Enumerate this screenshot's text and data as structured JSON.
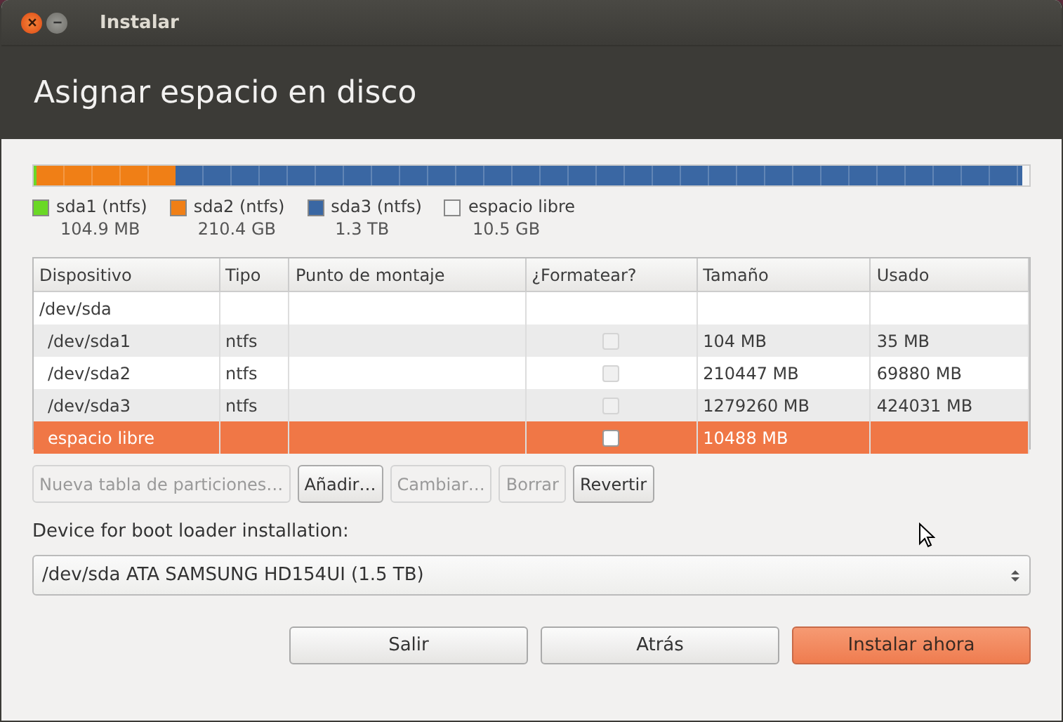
{
  "window": {
    "title": "Instalar"
  },
  "header": {
    "title": "Asignar espacio en disco"
  },
  "partition_bar": {
    "segments": [
      {
        "color": "#6ad825",
        "level": 0.001
      },
      {
        "color": "#f07f16",
        "level": 0.14
      },
      {
        "color": "#3a67a3",
        "level": 0.852
      },
      {
        "color": "#f4f4f4",
        "level": 0.007
      }
    ]
  },
  "legend": [
    {
      "name": "sda1 (ntfs)",
      "size": "104.9 MB",
      "color": "#6ad825"
    },
    {
      "name": "sda2 (ntfs)",
      "size": "210.4 GB",
      "color": "#f07f16"
    },
    {
      "name": "sda3 (ntfs)",
      "size": "1.3 TB",
      "color": "#3a67a3"
    },
    {
      "name": "espacio libre",
      "size": "10.5 GB",
      "color": "#f4f4f4"
    }
  ],
  "table": {
    "columns": [
      "Dispositivo",
      "Tipo",
      "Punto de montaje",
      "¿Formatear?",
      "Tamaño",
      "Usado"
    ],
    "rows": [
      {
        "kind": "disk",
        "device": "/dev/sda",
        "selected": false
      },
      {
        "kind": "partition",
        "device": "/dev/sda1",
        "type": "ntfs",
        "format": {
          "checked": false,
          "disabled": true
        },
        "size": "104 MB",
        "used": "35 MB",
        "selected": false
      },
      {
        "kind": "partition",
        "device": "/dev/sda2",
        "type": "ntfs",
        "format": {
          "checked": false,
          "disabled": true
        },
        "size": "210447 MB",
        "used": "69880 MB",
        "selected": false
      },
      {
        "kind": "partition",
        "device": "/dev/sda3",
        "type": "ntfs",
        "format": {
          "checked": false,
          "disabled": true
        },
        "size": "1279260 MB",
        "used": "424031 MB",
        "selected": false
      },
      {
        "kind": "partition",
        "device": "espacio libre",
        "format": {
          "checked": false,
          "disabled": false
        },
        "size": "10488 MB",
        "selected": true
      }
    ]
  },
  "table_buttons": [
    {
      "label": "Nueva tabla de particiones…",
      "disabled": true
    },
    {
      "label": "Añadir…",
      "disabled": false
    },
    {
      "label": "Cambiar…",
      "disabled": true
    },
    {
      "label": "Borrar",
      "disabled": true
    },
    {
      "label": "Revertir",
      "disabled": false
    }
  ],
  "boot_loader": {
    "label": "Device for boot loader installation:",
    "value": "/dev/sda ATA SAMSUNG HD154UI (1.5 TB)"
  },
  "buttons": [
    {
      "label": "Salir",
      "kind": "normal"
    },
    {
      "label": "Atrás",
      "kind": "normal"
    },
    {
      "label": "Instalar ahora",
      "kind": "primary"
    }
  ]
}
